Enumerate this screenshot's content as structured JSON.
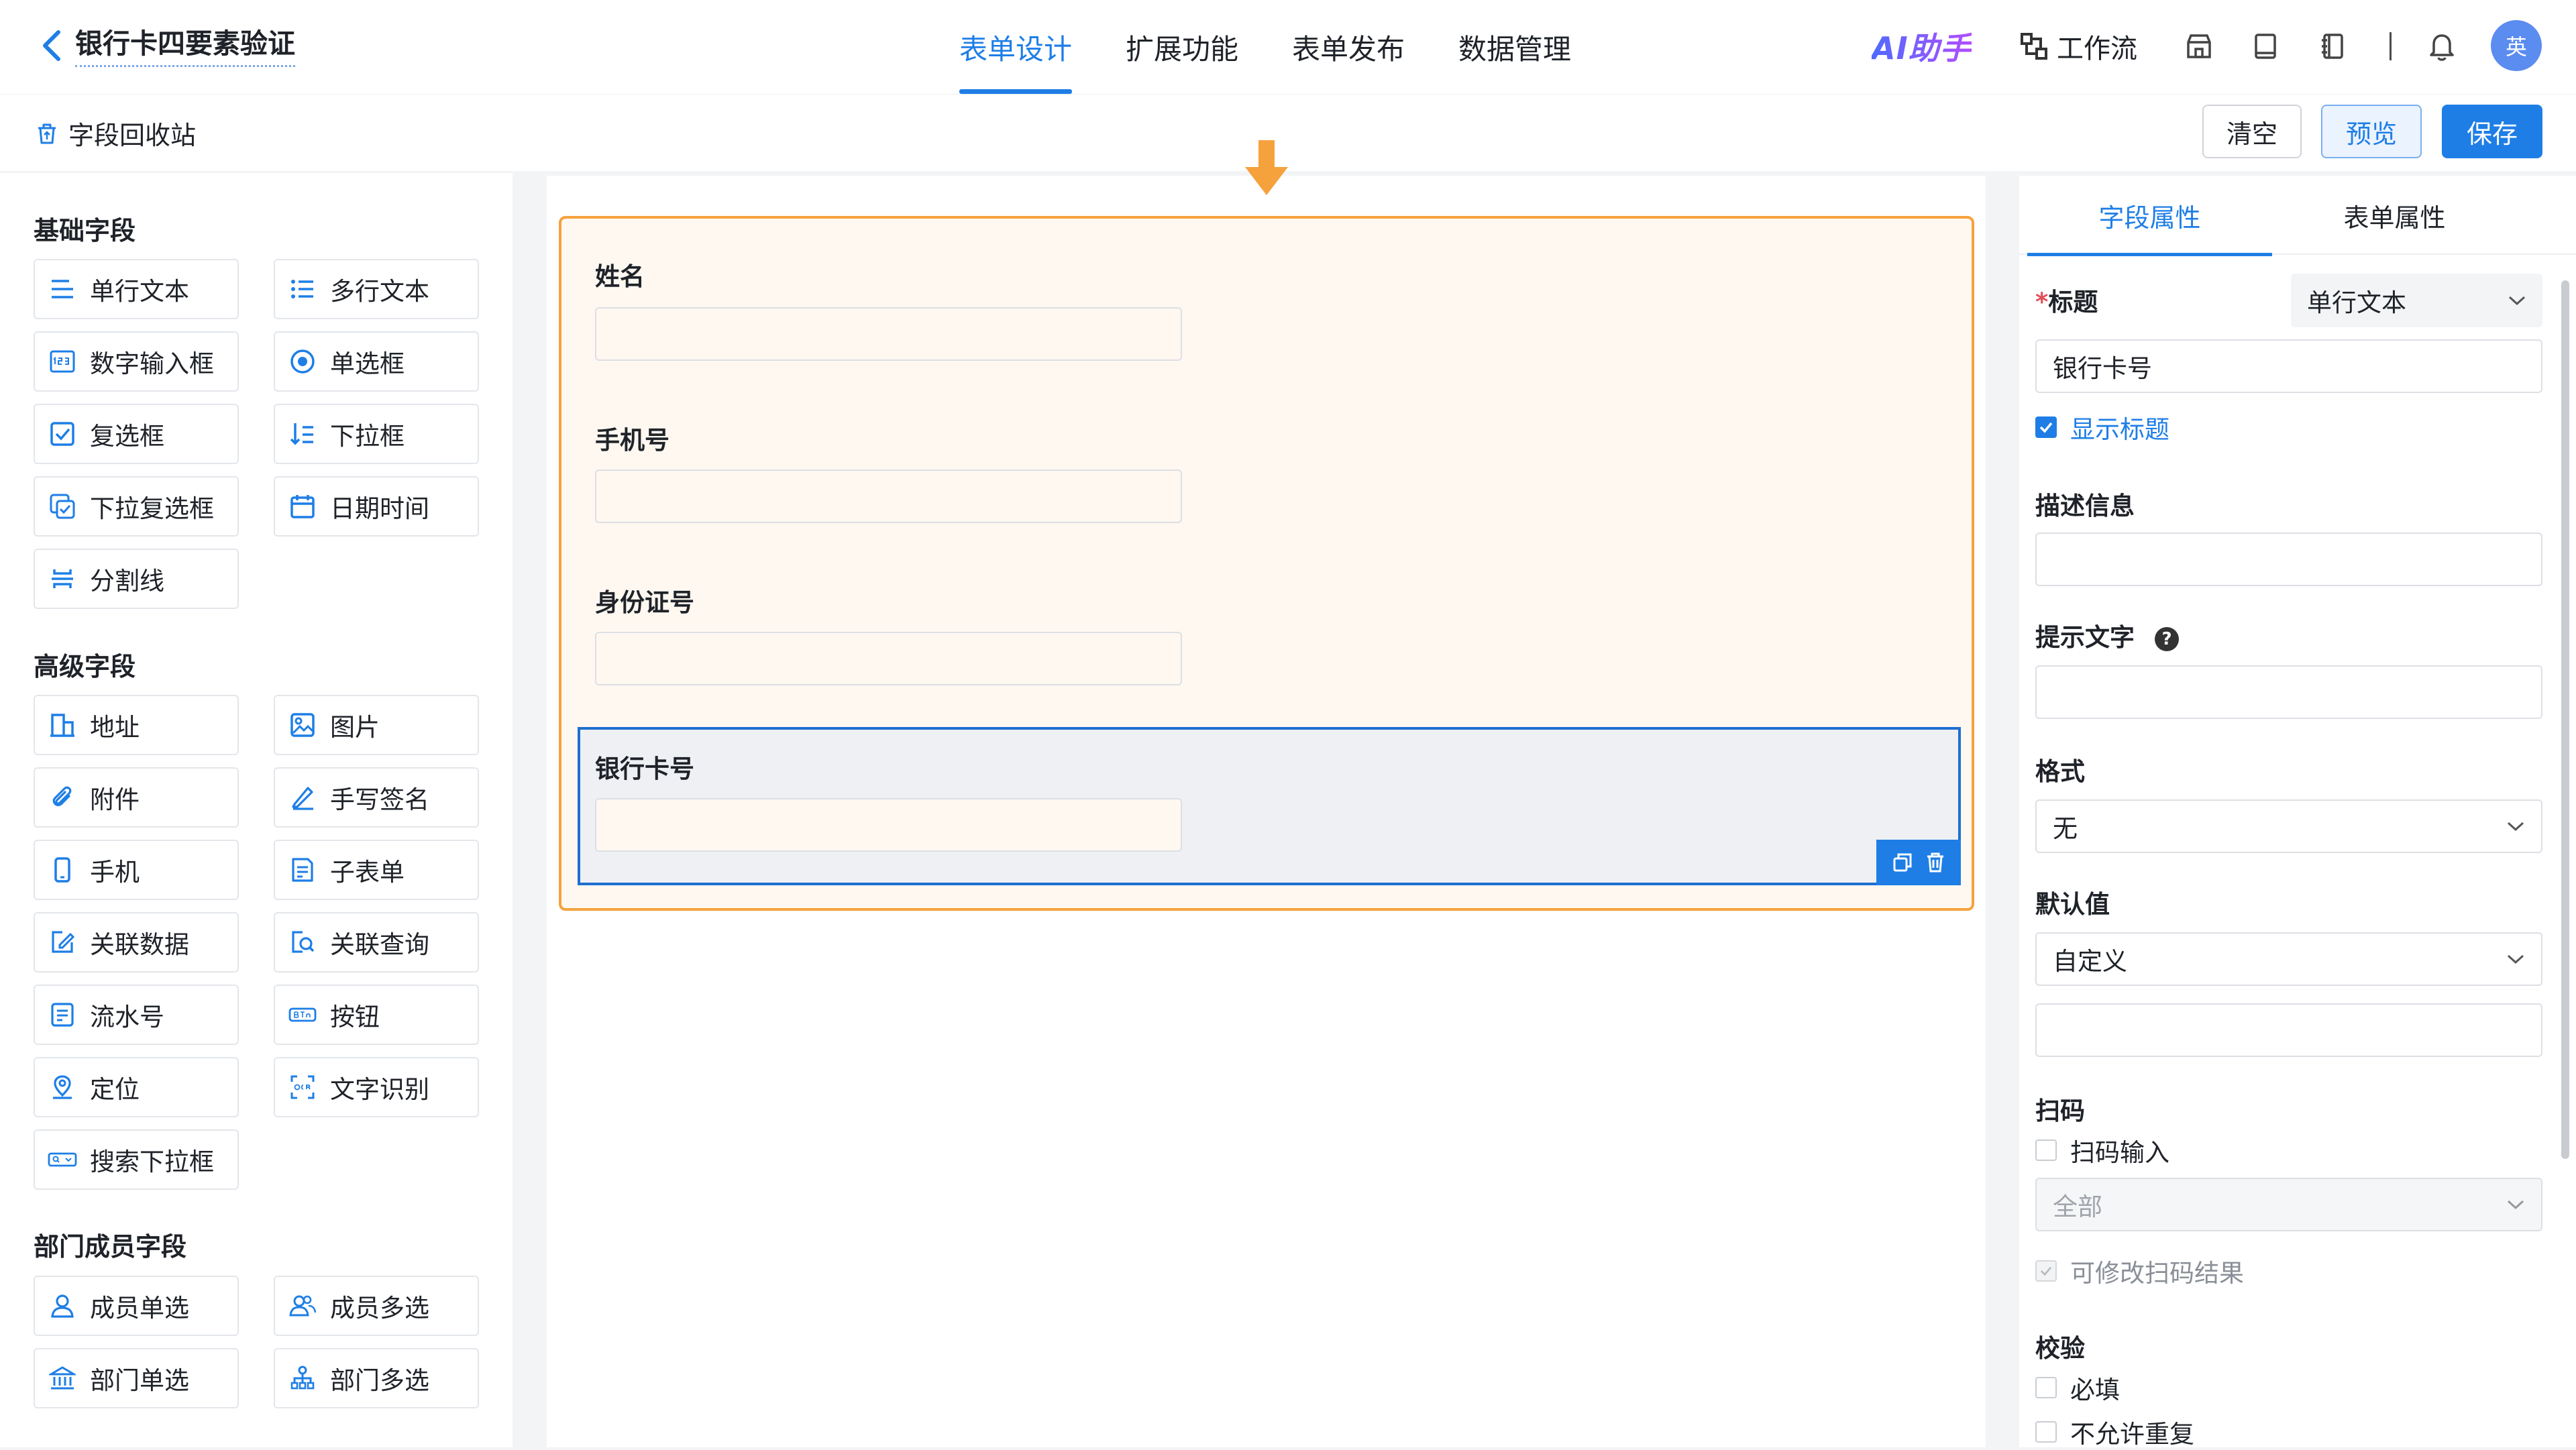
{
  "header": {
    "title": "银行卡四要素验证",
    "tabs": [
      {
        "label": "表单设计",
        "active": true
      },
      {
        "label": "扩展功能",
        "active": false
      },
      {
        "label": "表单发布",
        "active": false
      },
      {
        "label": "数据管理",
        "active": false
      }
    ],
    "ai_label": "AI助手",
    "workflow_label": "工作流",
    "avatar_text": "英"
  },
  "toolbar": {
    "recycle_label": "字段回收站",
    "clear_label": "清空",
    "preview_label": "预览",
    "save_label": "保存"
  },
  "palette": {
    "basic_title": "基础字段",
    "basic": [
      "单行文本",
      "多行文本",
      "数字输入框",
      "单选框",
      "复选框",
      "下拉框",
      "下拉复选框",
      "日期时间",
      "分割线"
    ],
    "advanced_title": "高级字段",
    "advanced": [
      "地址",
      "图片",
      "附件",
      "手写签名",
      "手机",
      "子表单",
      "关联数据",
      "关联查询",
      "流水号",
      "按钮",
      "定位",
      "文字识别",
      "搜索下拉框"
    ],
    "member_title": "部门成员字段",
    "member": [
      "成员单选",
      "成员多选",
      "部门单选",
      "部门多选"
    ]
  },
  "form": {
    "fields": [
      "姓名",
      "手机号",
      "身份证号"
    ],
    "selected_field": "银行卡号"
  },
  "props": {
    "tabs": [
      "字段属性",
      "表单属性"
    ],
    "title_req": "*",
    "title_label": "标题",
    "field_type": "单行文本",
    "title_value": "银行卡号",
    "show_title": "显示标题",
    "desc_label": "描述信息",
    "hint_label": "提示文字",
    "format_label": "格式",
    "format_value": "无",
    "default_label": "默认值",
    "default_value": "自定义",
    "scan_label": "扫码",
    "scan_input": "扫码输入",
    "scan_scope": "全部",
    "scan_editable": "可修改扫码结果",
    "validate_label": "校验",
    "required": "必填",
    "no_repeat": "不允许重复"
  },
  "colors": {
    "accent": "#1e7ee6",
    "drop_highlight": "#f5a23d",
    "form_bg": "#fff8f1"
  }
}
